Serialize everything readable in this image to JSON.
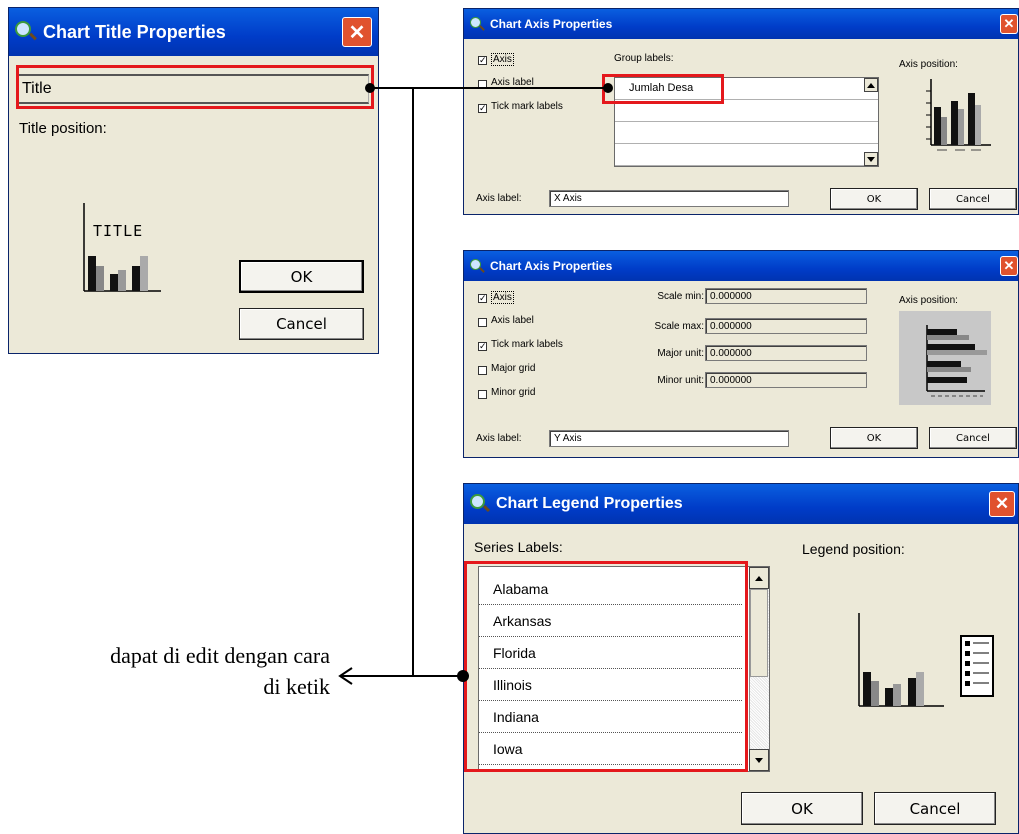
{
  "title_dialog": {
    "title": "Chart Title Properties",
    "title_value": "Title",
    "position_label": "Title position:",
    "preview_text": "TITLE",
    "ok_label": "OK",
    "cancel_label": "Cancel"
  },
  "x_axis_dialog": {
    "title": "Chart Axis Properties",
    "checkboxes": [
      {
        "label": "Axis",
        "checked": true
      },
      {
        "label": "Axis label",
        "checked": false
      },
      {
        "label": "Tick mark labels",
        "checked": true
      }
    ],
    "group_labels_label": "Group labels:",
    "group_labels": [
      "Jumlah Desa",
      "",
      "",
      ""
    ],
    "position_label": "Axis position:",
    "axis_label_caption": "Axis label:",
    "axis_label_value": "X Axis",
    "ok_label": "OK",
    "cancel_label": "Cancel"
  },
  "y_axis_dialog": {
    "title": "Chart Axis Properties",
    "checkboxes": [
      {
        "label": "Axis",
        "checked": true
      },
      {
        "label": "Axis label",
        "checked": false
      },
      {
        "label": "Tick mark labels",
        "checked": true
      },
      {
        "label": "Major grid",
        "checked": false
      },
      {
        "label": "Minor grid",
        "checked": false
      }
    ],
    "scale_fields": [
      {
        "label": "Scale min:",
        "value": "0.000000"
      },
      {
        "label": "Scale max:",
        "value": "0.000000"
      },
      {
        "label": "Major unit:",
        "value": "0.000000"
      },
      {
        "label": "Minor unit:",
        "value": "0.000000"
      }
    ],
    "position_label": "Axis position:",
    "axis_label_caption": "Axis label:",
    "axis_label_value": "Y Axis",
    "ok_label": "OK",
    "cancel_label": "Cancel"
  },
  "legend_dialog": {
    "title": "Chart Legend Properties",
    "series_labels_label": "Series Labels:",
    "series_labels": [
      "Alabama",
      "Arkansas",
      "Florida",
      "Illinois",
      "Indiana",
      "Iowa"
    ],
    "position_label": "Legend position:",
    "ok_label": "OK",
    "cancel_label": "Cancel"
  },
  "annotation": {
    "line1": "dapat di edit dengan cara",
    "line2": "di ketik"
  },
  "colors": {
    "titlebar": "#0a5fe0",
    "dialog_bg": "#ece9d8",
    "highlight": "#e4181c",
    "close_button": "#e0522e"
  }
}
